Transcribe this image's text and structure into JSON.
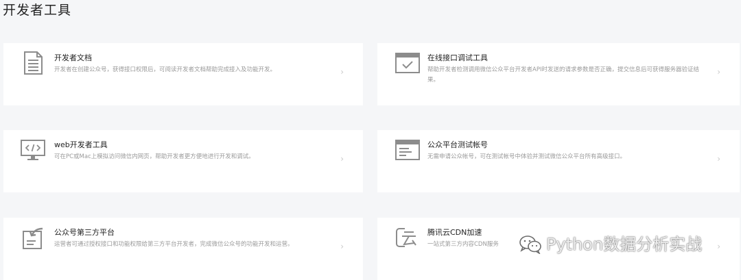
{
  "page": {
    "title": "开发者工具"
  },
  "cards": [
    {
      "title": "开发者文档",
      "desc": "开发者在创建公众号，获得接口权限后，可阅读开发者文档帮助完成接入及功能开发。",
      "icon": "document-icon",
      "arrow": "›"
    },
    {
      "title": "在线接口调试工具",
      "desc": "帮助开发者检测调用微信公众平台开发者API时发送的请求参数是否正确，提交信息后可获得服务器验证结果。",
      "icon": "debug-window-icon",
      "arrow": "›"
    },
    {
      "title": "web开发者工具",
      "desc": "可在PC或Mac上模拟访问微信内网页，帮助开发者更方便地进行开发和调试。",
      "icon": "code-monitor-icon",
      "arrow": "›"
    },
    {
      "title": "公众平台测试帐号",
      "desc": "无需申请公众帐号，可在测试帐号中体验并测试微信公众平台所有高级接口。",
      "icon": "test-account-window-icon",
      "arrow": "›"
    },
    {
      "title": "公众号第三方平台",
      "desc": "运营者可通过授权接口和功能权限给第三方平台开发者，完成微信公众号的功能开发和运营。",
      "icon": "third-party-platform-icon",
      "arrow": "›"
    },
    {
      "title": "腾讯云CDN加速",
      "desc": "一站式第三方内容CDN服务",
      "icon": "cloud-cdn-icon",
      "arrow": "›"
    }
  ],
  "watermark": {
    "text": "Python数据分析实战",
    "icon": "wechat-icon"
  },
  "colors": {
    "background": "#f5f6f8",
    "card": "#ffffff",
    "icon": "#8c8c8c",
    "desc": "#9a9a9a",
    "title": "#222222"
  }
}
